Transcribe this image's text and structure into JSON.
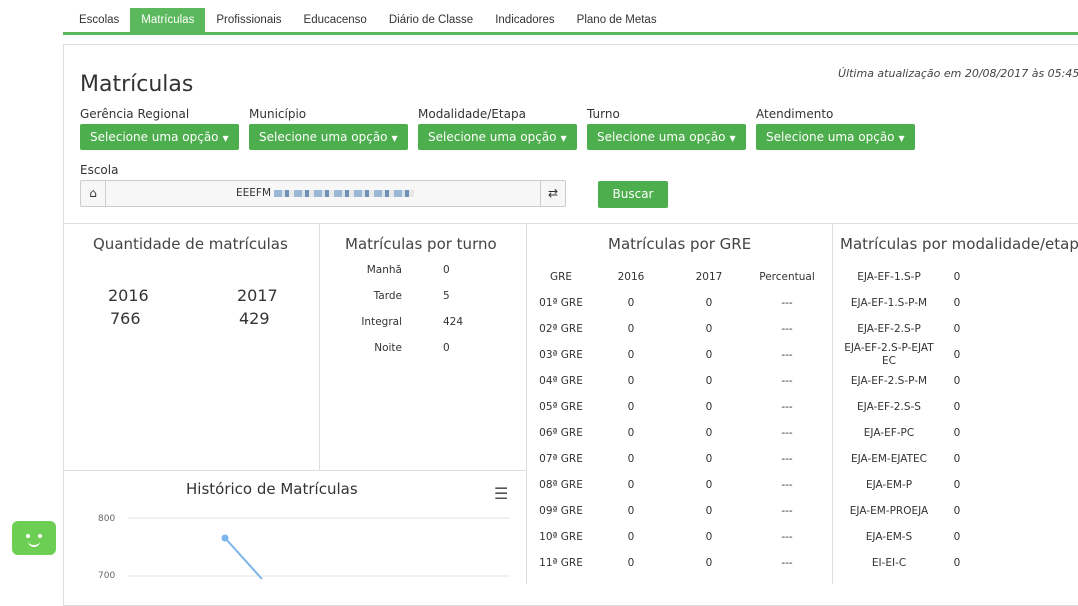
{
  "tabs": [
    "Escolas",
    "Matrículas",
    "Profissionais",
    "Educacenso",
    "Diário de Classe",
    "Indicadores",
    "Plano de Metas"
  ],
  "active_tab": "Matrículas",
  "page_title": "Matrículas",
  "last_update": "Última atualização em 20/08/2017 às 05:45",
  "filters": {
    "gerencia": {
      "label": "Gerência Regional",
      "value": "Selecione uma opção"
    },
    "municipio": {
      "label": "Município",
      "value": "Selecione uma opção"
    },
    "modalidade": {
      "label": "Modalidade/Etapa",
      "value": "Selecione uma opção"
    },
    "turno": {
      "label": "Turno",
      "value": "Selecione uma opção"
    },
    "atendimento": {
      "label": "Atendimento",
      "value": "Selecione uma opção"
    },
    "escola": {
      "label": "Escola",
      "value": "EEEFM"
    },
    "buscar_label": "Buscar"
  },
  "quantidade": {
    "title": "Quantidade de matrículas",
    "year1": "2016",
    "val1": "766",
    "year2": "2017",
    "val2": "429"
  },
  "turno": {
    "title": "Matrículas por turno",
    "rows": [
      {
        "label": "Manhã",
        "value": "0"
      },
      {
        "label": "Tarde",
        "value": "5"
      },
      {
        "label": "Integral",
        "value": "424"
      },
      {
        "label": "Noite",
        "value": "0"
      }
    ]
  },
  "gre": {
    "title": "Matrículas por GRE",
    "headers": [
      "GRE",
      "2016",
      "2017",
      "Percentual"
    ],
    "rows": [
      [
        "01ª GRE",
        "0",
        "0",
        "---"
      ],
      [
        "02ª GRE",
        "0",
        "0",
        "---"
      ],
      [
        "03ª GRE",
        "0",
        "0",
        "---"
      ],
      [
        "04ª GRE",
        "0",
        "0",
        "---"
      ],
      [
        "05ª GRE",
        "0",
        "0",
        "---"
      ],
      [
        "06ª GRE",
        "0",
        "0",
        "---"
      ],
      [
        "07ª GRE",
        "0",
        "0",
        "---"
      ],
      [
        "08ª GRE",
        "0",
        "0",
        "---"
      ],
      [
        "09ª GRE",
        "0",
        "0",
        "---"
      ],
      [
        "10ª GRE",
        "0",
        "0",
        "---"
      ],
      [
        "11ª GRE",
        "0",
        "0",
        "---"
      ]
    ]
  },
  "modalidade": {
    "title": "Matrículas por modalidade/etapa",
    "rows": [
      {
        "name": "EJA-EF-1.S-P",
        "value": "0"
      },
      {
        "name": "EJA-EF-1.S-P-M",
        "value": "0"
      },
      {
        "name": "EJA-EF-2.S-P",
        "value": "0"
      },
      {
        "name": "EJA-EF-2.S-P-EJATEC",
        "value": "0"
      },
      {
        "name": "EJA-EF-2.S-P-M",
        "value": "0"
      },
      {
        "name": "EJA-EF-2.S-S",
        "value": "0"
      },
      {
        "name": "EJA-EF-PC",
        "value": "0"
      },
      {
        "name": "EJA-EM-EJATEC",
        "value": "0"
      },
      {
        "name": "EJA-EM-P",
        "value": "0"
      },
      {
        "name": "EJA-EM-PROEJA",
        "value": "0"
      },
      {
        "name": "EJA-EM-S",
        "value": "0"
      },
      {
        "name": "EI-EI-C",
        "value": "0"
      }
    ]
  },
  "historico": {
    "title": "Histórico de Matrículas",
    "y_ticks": [
      "800",
      "700"
    ]
  },
  "colors": {
    "accent": "#5cb85c",
    "button": "#4cae4c",
    "line": "#7cb5ec"
  }
}
